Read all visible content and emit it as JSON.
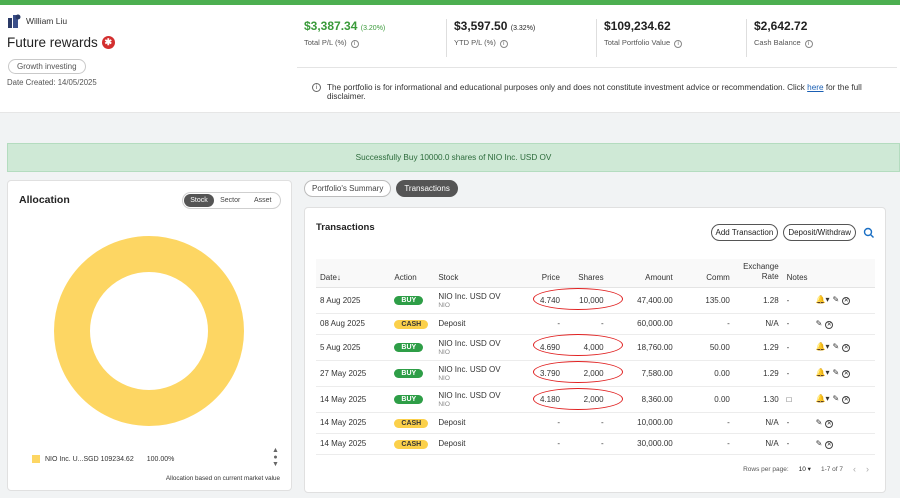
{
  "header": {
    "owner_name": "William Liu",
    "portfolio_name": "Future rewards",
    "tag": "Growth investing",
    "date_created": "Date Created: 14/05/2025"
  },
  "stats": [
    {
      "value": "$3,387.34",
      "change": "(3.20%)",
      "label": "Total P/L (%)"
    },
    {
      "value": "$3,597.50",
      "change": "(3.32%)",
      "label": "YTD P/L (%)"
    },
    {
      "value": "$109,234.62",
      "change": "",
      "label": "Total Portfolio Value"
    },
    {
      "value": "$2,642.72",
      "change": "",
      "label": "Cash Balance"
    }
  ],
  "disclaimer": {
    "text": "The portfolio is for informational and educational purposes only and does not constitute investment advice or recommendation. Click",
    "link": "here",
    "suffix": "for the full disclaimer."
  },
  "success_message": "Successfully Buy 10000.0 shares of NIO Inc. USD OV",
  "allocation": {
    "title": "Allocation",
    "segments": [
      "Stock",
      "Sector",
      "Asset"
    ],
    "active_segment": "Stock",
    "legend_label": "NIO Inc. U...SGD 109234.62",
    "legend_pct": "100.00%",
    "legend_color": "#fdd663",
    "basis_note": "Allocation based on current market value"
  },
  "tabs": [
    "Portfolio's Summary",
    "Transactions"
  ],
  "active_tab": "Transactions",
  "transactions": {
    "title": "Transactions",
    "add_label": "Add Transaction",
    "deposit_label": "Deposit/Withdraw",
    "columns": {
      "date": "Date↓",
      "action": "Action",
      "stock": "Stock",
      "price": "Price",
      "shares": "Shares",
      "amount": "Amount",
      "comm": "Comm",
      "rate": "Exchange Rate",
      "notes": "Notes"
    },
    "rows": [
      {
        "date": "8 Aug 2025",
        "action": "BUY",
        "stock": "NIO Inc. USD OV",
        "sub": "NIO",
        "price": "4.740",
        "shares": "10,000",
        "amount": "47,400.00",
        "comm": "135.00",
        "rate": "1.28",
        "notes": "-"
      },
      {
        "date": "08 Aug 2025",
        "action": "CASH",
        "stock": "Deposit",
        "sub": "",
        "price": "-",
        "shares": "-",
        "amount": "60,000.00",
        "comm": "-",
        "rate": "N/A",
        "notes": "-"
      },
      {
        "date": "5 Aug 2025",
        "action": "BUY",
        "stock": "NIO Inc. USD OV",
        "sub": "NIO",
        "price": "4.690",
        "shares": "4,000",
        "amount": "18,760.00",
        "comm": "50.00",
        "rate": "1.29",
        "notes": "-"
      },
      {
        "date": "27 May 2025",
        "action": "BUY",
        "stock": "NIO Inc. USD OV",
        "sub": "NIO",
        "price": "3.790",
        "shares": "2,000",
        "amount": "7,580.00",
        "comm": "0.00",
        "rate": "1.29",
        "notes": "-"
      },
      {
        "date": "14 May 2025",
        "action": "BUY",
        "stock": "NIO Inc. USD OV",
        "sub": "NIO",
        "price": "4.180",
        "shares": "2,000",
        "amount": "8,360.00",
        "comm": "0.00",
        "rate": "1.30",
        "notes": "□"
      },
      {
        "date": "14 May 2025",
        "action": "CASH",
        "stock": "Deposit",
        "sub": "",
        "price": "-",
        "shares": "-",
        "amount": "10,000.00",
        "comm": "-",
        "rate": "N/A",
        "notes": "-"
      },
      {
        "date": "14 May 2025",
        "action": "CASH",
        "stock": "Deposit",
        "sub": "",
        "price": "-",
        "shares": "-",
        "amount": "30,000.00",
        "comm": "-",
        "rate": "N/A",
        "notes": "-"
      }
    ],
    "pager": {
      "rows_label": "Rows per page:",
      "rows_value": "10",
      "range": "1-7 of 7"
    }
  },
  "colors": {
    "buy": "#2e9e47",
    "cash": "#fbd04a",
    "success_bg": "#cfe9d6",
    "positive": "#3a9a3a"
  }
}
